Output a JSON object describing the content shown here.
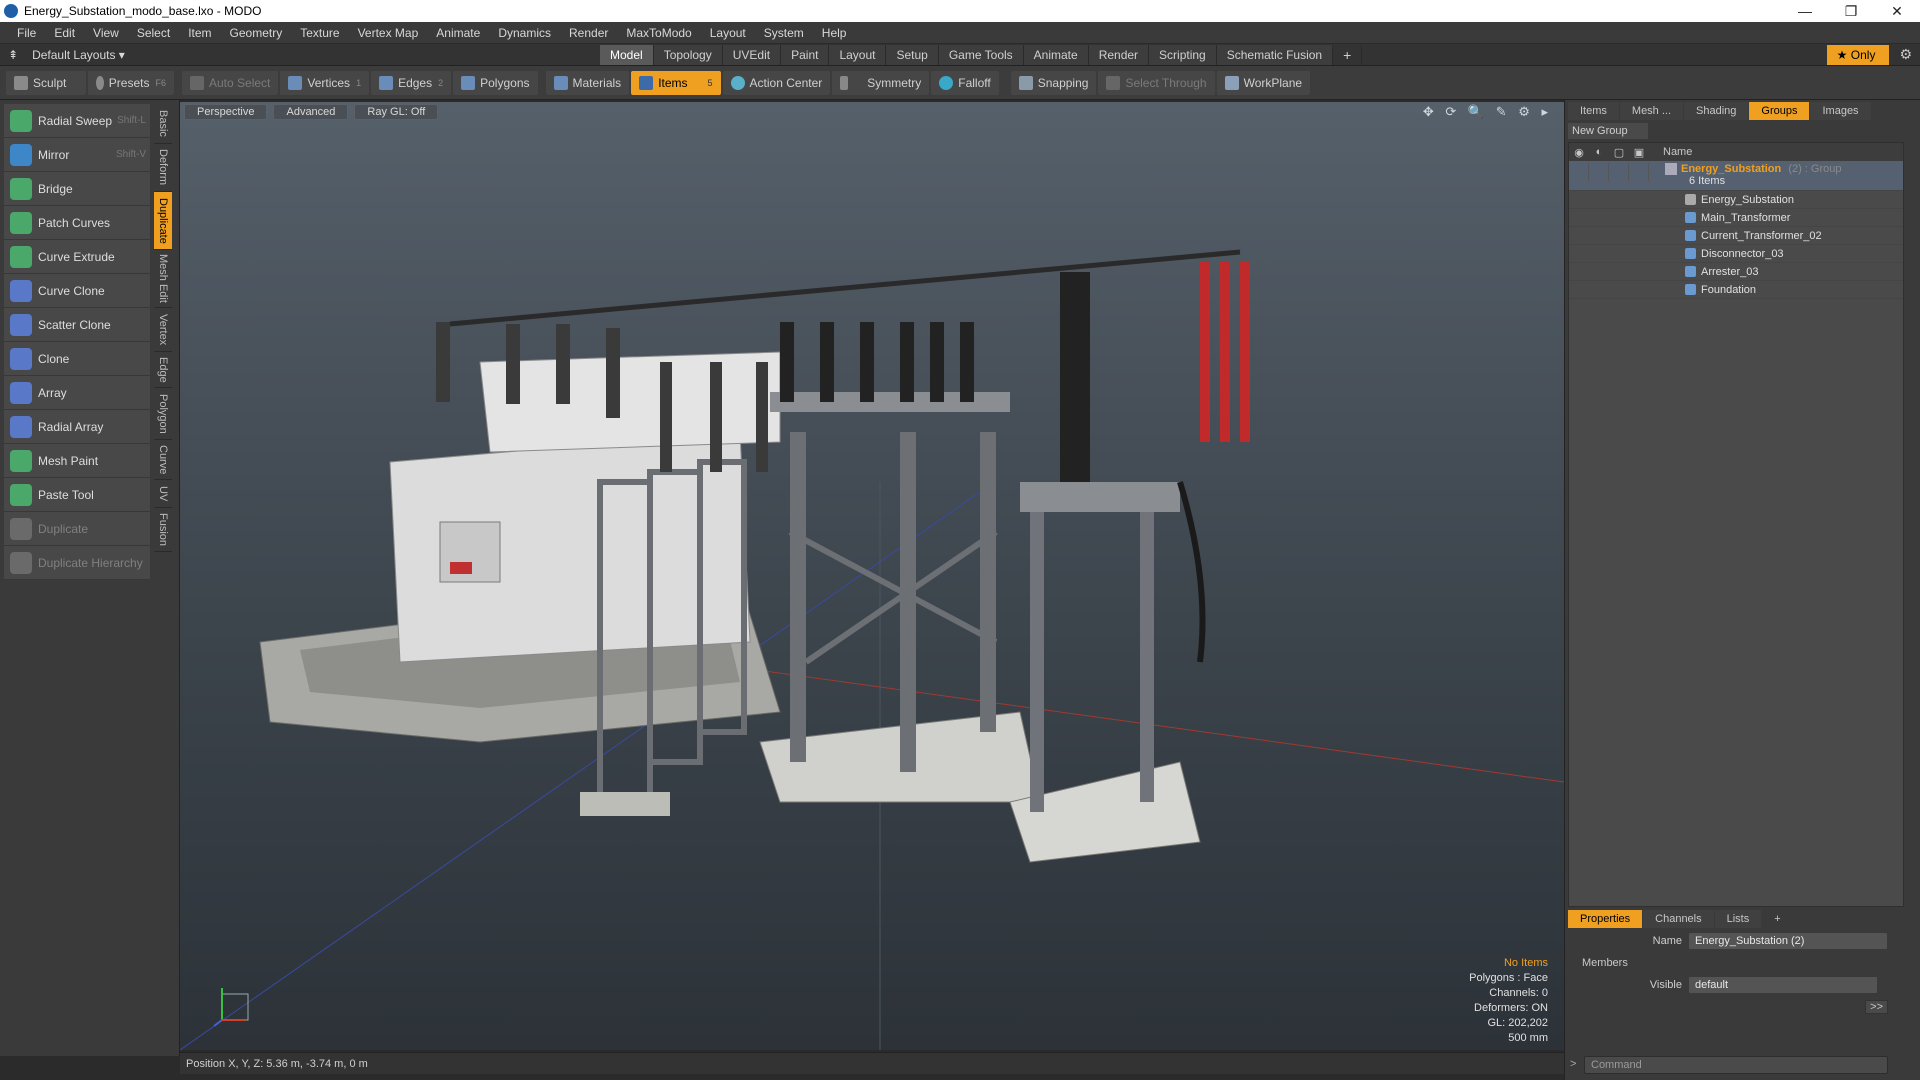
{
  "window": {
    "title": "Energy_Substation_modo_base.lxo - MODO",
    "minimize": "—",
    "maximize": "❐",
    "close": "✕"
  },
  "menu": [
    "File",
    "Edit",
    "View",
    "Select",
    "Item",
    "Geometry",
    "Texture",
    "Vertex Map",
    "Animate",
    "Dynamics",
    "Render",
    "MaxToModo",
    "Layout",
    "System",
    "Help"
  ],
  "layoutbar": {
    "layouts_label": "Default Layouts ▾",
    "tabs": [
      "Model",
      "Topology",
      "UVEdit",
      "Paint",
      "Layout",
      "Setup",
      "Game Tools",
      "Animate",
      "Render",
      "Scripting",
      "Schematic Fusion"
    ],
    "active_tab": "Model",
    "add": "+",
    "only_label": "★ Only",
    "gear": "⚙"
  },
  "toolbar": {
    "sculpt": "Sculpt",
    "presets": "Presets",
    "presets_shortcut": "F6",
    "auto_select": "Auto Select",
    "vertices": "Vertices",
    "vertices_num": "1",
    "edges": "Edges",
    "edges_num": "2",
    "polygons": "Polygons",
    "materials": "Materials",
    "items": "Items",
    "items_num": "5",
    "action_center": "Action Center",
    "symmetry": "Symmetry",
    "falloff": "Falloff",
    "snapping": "Snapping",
    "select_through": "Select Through",
    "workplane": "WorkPlane"
  },
  "tools": [
    {
      "label": "Radial Sweep",
      "shortcut": "Shift-L",
      "color": "#4aa86a"
    },
    {
      "label": "Mirror",
      "shortcut": "Shift-V",
      "color": "#3d86c8"
    },
    {
      "label": "Bridge",
      "shortcut": "",
      "color": "#4aa86a"
    },
    {
      "label": "Patch Curves",
      "shortcut": "",
      "color": "#4aa86a"
    },
    {
      "label": "Curve Extrude",
      "shortcut": "",
      "color": "#4aa86a"
    },
    {
      "label": "Curve Clone",
      "shortcut": "",
      "color": "#5a78c8"
    },
    {
      "label": "Scatter Clone",
      "shortcut": "",
      "color": "#5a78c8"
    },
    {
      "label": "Clone",
      "shortcut": "",
      "color": "#5a78c8"
    },
    {
      "label": "Array",
      "shortcut": "",
      "color": "#5a78c8"
    },
    {
      "label": "Radial Array",
      "shortcut": "",
      "color": "#5a78c8"
    },
    {
      "label": "Mesh Paint",
      "shortcut": "",
      "color": "#4aa86a"
    },
    {
      "label": "Paste Tool",
      "shortcut": "",
      "color": "#4aa86a"
    },
    {
      "label": "Duplicate",
      "shortcut": "",
      "color": "#6a6a6a"
    },
    {
      "label": "Duplicate Hierarchy",
      "shortcut": "",
      "color": "#6a6a6a"
    }
  ],
  "vtabs": [
    "Basic",
    "Deform",
    "Duplicate",
    "Mesh Edit",
    "Vertex",
    "Edge",
    "Polygon",
    "Curve",
    "UV",
    "Fusion"
  ],
  "vtab_active": "Duplicate",
  "viewport": {
    "perspective": "Perspective",
    "advanced": "Advanced",
    "raygl": "Ray GL: Off",
    "icons": "✥ ⟳ 🔍 ✎ ⚙ ▸",
    "status_title": "No Items",
    "status_lines": [
      "Polygons : Face",
      "Channels: 0",
      "Deformers: ON",
      "GL: 202,202",
      "500 mm"
    ]
  },
  "bottombar": {
    "position": "Position X, Y, Z:   5.36 m, -3.74 m, 0 m"
  },
  "rightpanel": {
    "tabs": [
      "Items",
      "Mesh ...",
      "Shading",
      "Groups",
      "Images"
    ],
    "active_tab": "Groups",
    "new_group": "New Group",
    "name_header": "Name",
    "group_name": "Energy_Substation",
    "group_suffix": "(2) : Group",
    "group_count": "6 Items",
    "children": [
      "Energy_Substation",
      "Main_Transformer",
      "Current_Transformer_02",
      "Disconnector_03",
      "Arrester_03",
      "Foundation"
    ]
  },
  "properties": {
    "tabs": [
      "Properties",
      "Channels",
      "Lists"
    ],
    "active_tab": "Properties",
    "add": "+",
    "name_label": "Name",
    "name_value": "Energy_Substation (2)",
    "members_label": "Members",
    "visible_label": "Visible",
    "visible_value": "default",
    "expand": ">>"
  },
  "command": {
    "placeholder": "Command",
    "prompt": ">"
  },
  "colors": {
    "accent": "#f0a020",
    "panel": "#3a3a3a",
    "viewport_top": "#56606a",
    "viewport_bottom": "#2c3238"
  }
}
